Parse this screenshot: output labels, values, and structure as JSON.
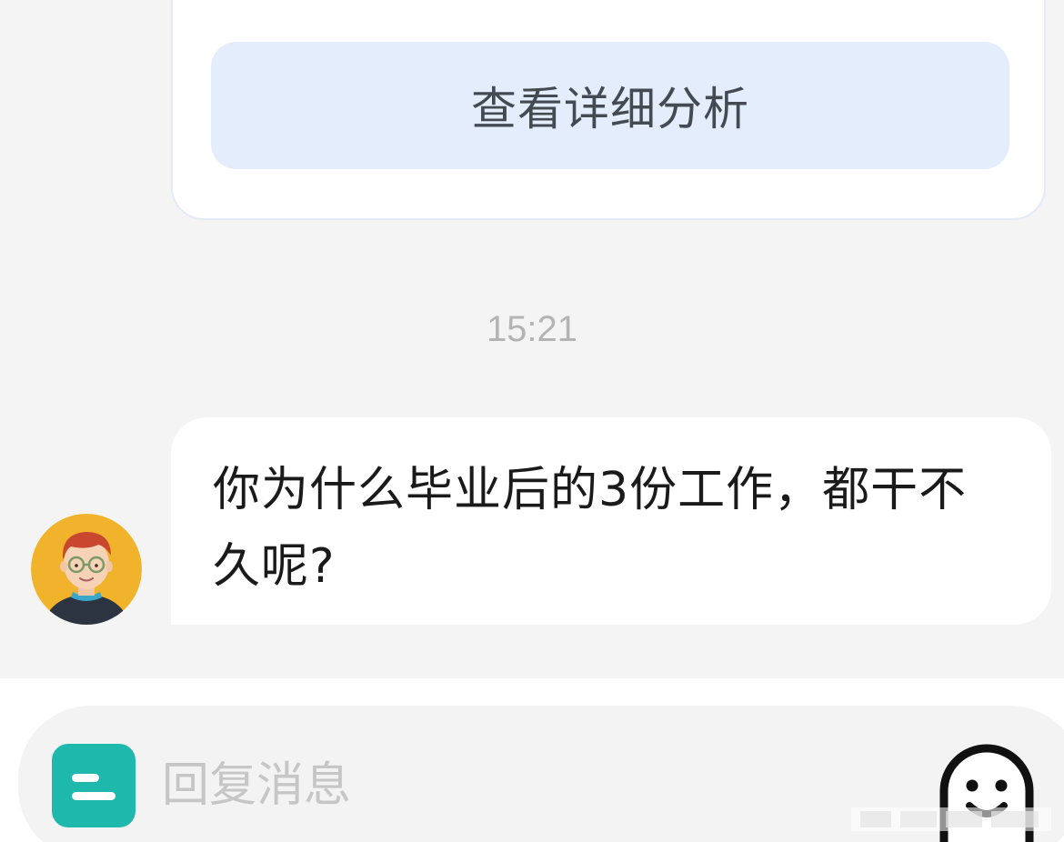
{
  "analysis_card": {
    "detail_button_label": "查看详细分析"
  },
  "timestamp": "15:21",
  "message": {
    "text": "你为什么毕业后的3份工作，都干不久呢?",
    "avatar_icon": "avatar-man-with-glasses"
  },
  "composer": {
    "placeholder": "回复消息",
    "app_icon": "app-logo-icon",
    "emoji_icon": "emoji-smiley-icon"
  },
  "colors": {
    "background": "#f4f4f4",
    "detail_button_bg": "#e3edfb",
    "app_icon_teal": "#1fb8ad",
    "avatar_bg": "#f2b32c"
  }
}
